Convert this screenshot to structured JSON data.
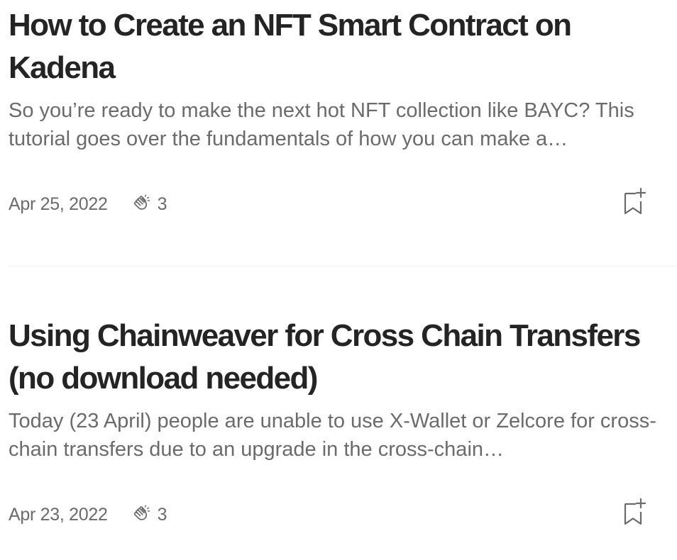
{
  "articles": [
    {
      "title": "How to Create an NFT Smart Contract on Kadena",
      "excerpt": "So you’re ready to make the next hot NFT collection like BAYC? This tutorial goes over the fundamentals of how you can make a…",
      "date": "Apr 25, 2022",
      "claps": "3"
    },
    {
      "title": "Using Chainweaver for Cross Chain Transfers (no download needed)",
      "excerpt": "Today (23 April) people are unable to use X-Wallet or Zelcore for cross-chain transfers due to an upgrade in the cross-chain…",
      "date": "Apr 23, 2022",
      "claps": "3"
    }
  ],
  "icons": {
    "clap": "clap-icon",
    "bookmark": "bookmark-add-icon"
  },
  "colors": {
    "title": "#242424",
    "secondary_text": "#6b6b6b",
    "divider": "#f0f0f0",
    "icon": "#6b6b6b"
  }
}
